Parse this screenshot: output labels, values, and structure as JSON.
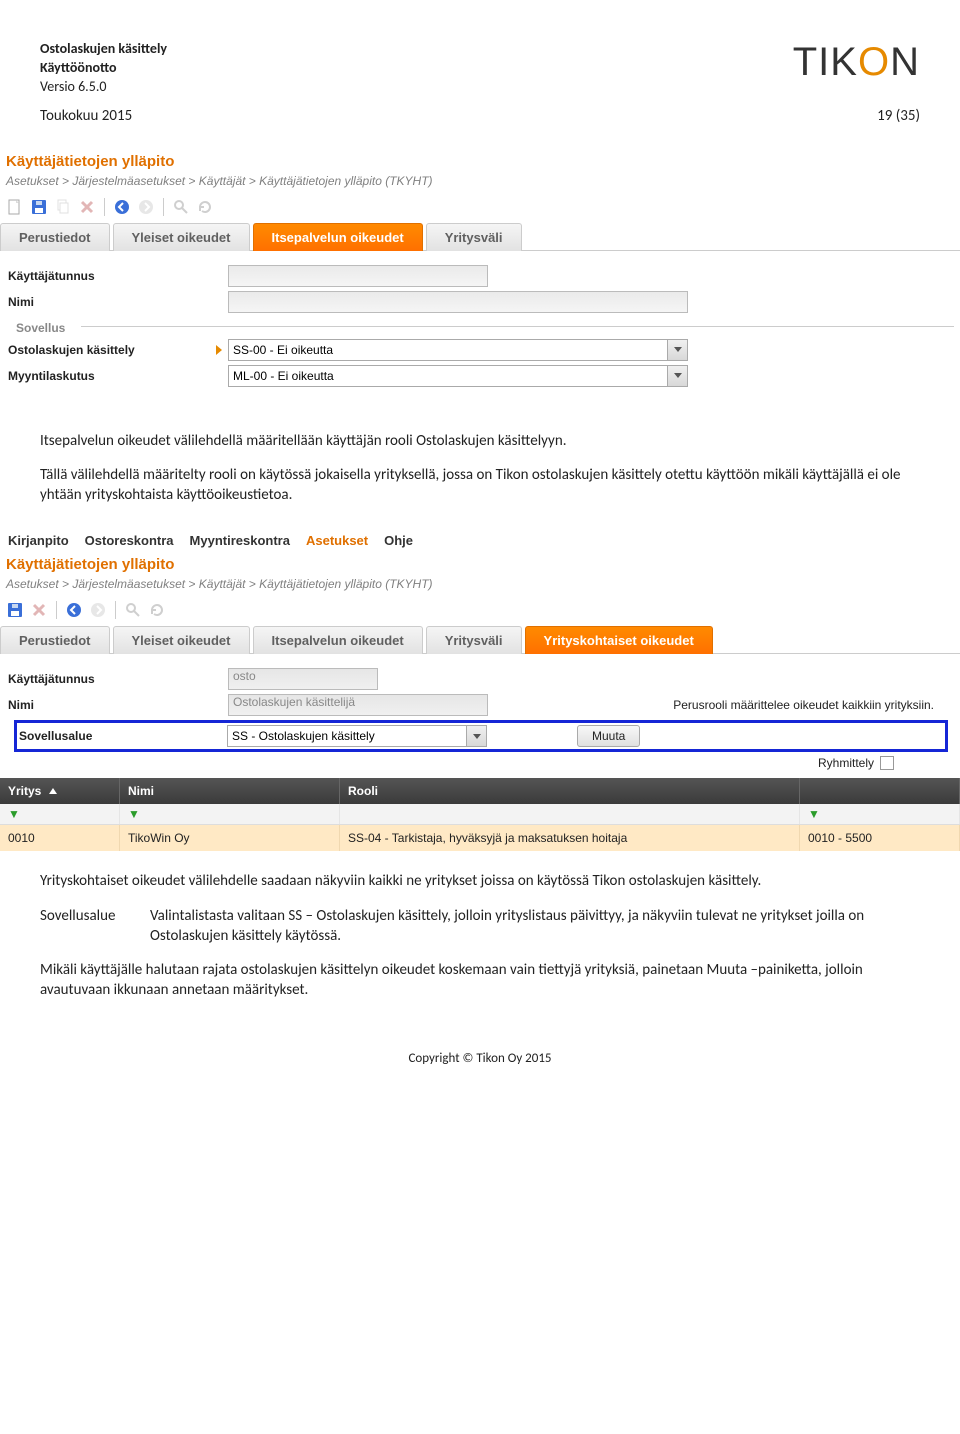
{
  "doc": {
    "title1": "Ostolaskujen käsittely",
    "title2": "Käyttöönotto",
    "version_label": "Versio 6.5.0",
    "date": "Toukokuu 2015",
    "page_of": "19 (35)",
    "logo_text": "TIK",
    "logo_accent": "O",
    "logo_text2": "N",
    "copyright": "Copyright © Tikon Oy 2015"
  },
  "screen1": {
    "section_title": "Käyttäjätietojen ylläpito",
    "breadcrumb": "Asetukset > Järjestelmäasetukset > Käyttäjät > Käyttäjätietojen ylläpito  (TKYHT)",
    "tabs": {
      "perustiedot": "Perustiedot",
      "yleiset": "Yleiset oikeudet",
      "itsepalvelu": "Itsepalvelun oikeudet",
      "yritysvali": "Yritysväli"
    },
    "fields": {
      "kayttajatunnus": "Käyttäjätunnus",
      "nimi": "Nimi",
      "sovellus_legend": "Sovellus",
      "ostolaskut": "Ostolaskujen käsittely",
      "myyntilaskutus": "Myyntilaskutus",
      "osto_value": "SS-00 - Ei oikeutta",
      "myynti_value": "ML-00 - Ei oikeutta"
    }
  },
  "para1": "Itsepalvelun oikeudet välilehdellä määritellään käyttäjän rooli Ostolaskujen käsittelyyn.",
  "para2": "Tällä välilehdellä määritelty rooli on käytössä jokaisella yrityksellä, jossa on Tikon ostolaskujen käsittely otettu  käyttöön mikäli käyttäjällä ei ole yhtään yrityskohtaista käyttöoikeustietoa.",
  "screen2": {
    "menu": {
      "kirjanpito": "Kirjanpito",
      "ostoreskontra": "Ostoreskontra",
      "myyntireskontra": "Myyntireskontra",
      "asetukset": "Asetukset",
      "ohje": "Ohje"
    },
    "section_title": "Käyttäjätietojen ylläpito",
    "breadcrumb": "Asetukset > Järjestelmäasetukset > Käyttäjät > Käyttäjätietojen ylläpito  (TKYHT)",
    "tabs": {
      "perustiedot": "Perustiedot",
      "yleiset": "Yleiset oikeudet",
      "itsepalvelu": "Itsepalvelun oikeudet",
      "yritysvali": "Yritysväli",
      "yrityskohtaiset": "Yrityskohtaiset oikeudet"
    },
    "fields": {
      "kayttajatunnus": "Käyttäjätunnus",
      "kayttajatunnus_value": "osto",
      "nimi": "Nimi",
      "nimi_value": "Ostolaskujen käsittelijä",
      "perusrooli_note": "Perusrooli määrittelee oikeudet kaikkiin yrityksiin.",
      "sovellusalue": "Sovellusalue",
      "sovellusalue_value": "SS - Ostolaskujen käsittely",
      "muuta_btn": "Muuta",
      "ryhmittely": "Ryhmittely"
    },
    "grid": {
      "col_yritys": "Yritys",
      "col_nimi": "Nimi",
      "col_rooli": "Rooli",
      "row": {
        "yritys": "0010",
        "nimi": "TikoWin Oy",
        "rooli": "SS-04 - Tarkistaja, hyväksyjä ja maksatuksen hoitaja",
        "extra": "0010 - 5500"
      }
    }
  },
  "para3": "Yrityskohtaiset oikeudet välilehdelle saadaan näkyviin kaikki ne yritykset joissa on käytössä Tikon ostolaskujen käsittely.",
  "sovellusalue_label": "Sovellusalue",
  "para4": "Valintalistasta valitaan SS – Ostolaskujen käsittely, jolloin yrityslistaus päivittyy, ja näkyviin tulevat ne yritykset joilla on Ostolaskujen käsittely käytössä.",
  "para5": "Mikäli käyttäjälle halutaan rajata ostolaskujen käsittelyn oikeudet koskemaan vain tiettyjä yrityksiä, painetaan Muuta –painiketta, jolloin avautuvaan ikkunaan annetaan määritykset."
}
